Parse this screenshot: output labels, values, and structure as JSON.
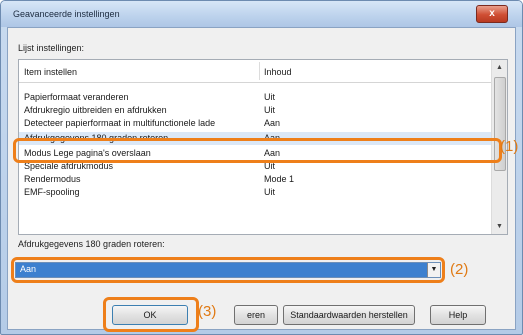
{
  "window": {
    "title": "Geavanceerde instellingen",
    "close_label": "x"
  },
  "list_label": "Lijst instellingen:",
  "list": {
    "headers": [
      "Item instellen",
      "Inhoud"
    ],
    "rows": [
      {
        "item": "Papierformaat veranderen",
        "value": "Uit"
      },
      {
        "item": "Afdrukregio uitbreiden en afdrukken",
        "value": "Uit"
      },
      {
        "item": "Detecteer papierformaat in multifunctionele lade",
        "value": "Aan"
      },
      {
        "item": "Afdrukgegevens 180 graden roteren",
        "value": "Aan",
        "selected": true
      },
      {
        "item": "Modus Lege pagina's overslaan",
        "value": "Aan"
      },
      {
        "item": "Speciale afdrukmodus",
        "value": "Uit"
      },
      {
        "item": "Rendermodus",
        "value": "Mode 1"
      },
      {
        "item": "EMF-spooling",
        "value": "Uit"
      }
    ]
  },
  "setting_label": "Afdrukgegevens 180 graden roteren:",
  "dropdown": {
    "value": "Aan"
  },
  "buttons": {
    "ok": "OK",
    "cancel_partial": "eren",
    "defaults": "Standaardwaarden herstellen",
    "help": "Help"
  },
  "callouts": {
    "one": "(1)",
    "two": "(2)",
    "three": "(3)"
  },
  "colors": {
    "highlight": "#ee7f1a",
    "selection": "#3c80cf"
  }
}
